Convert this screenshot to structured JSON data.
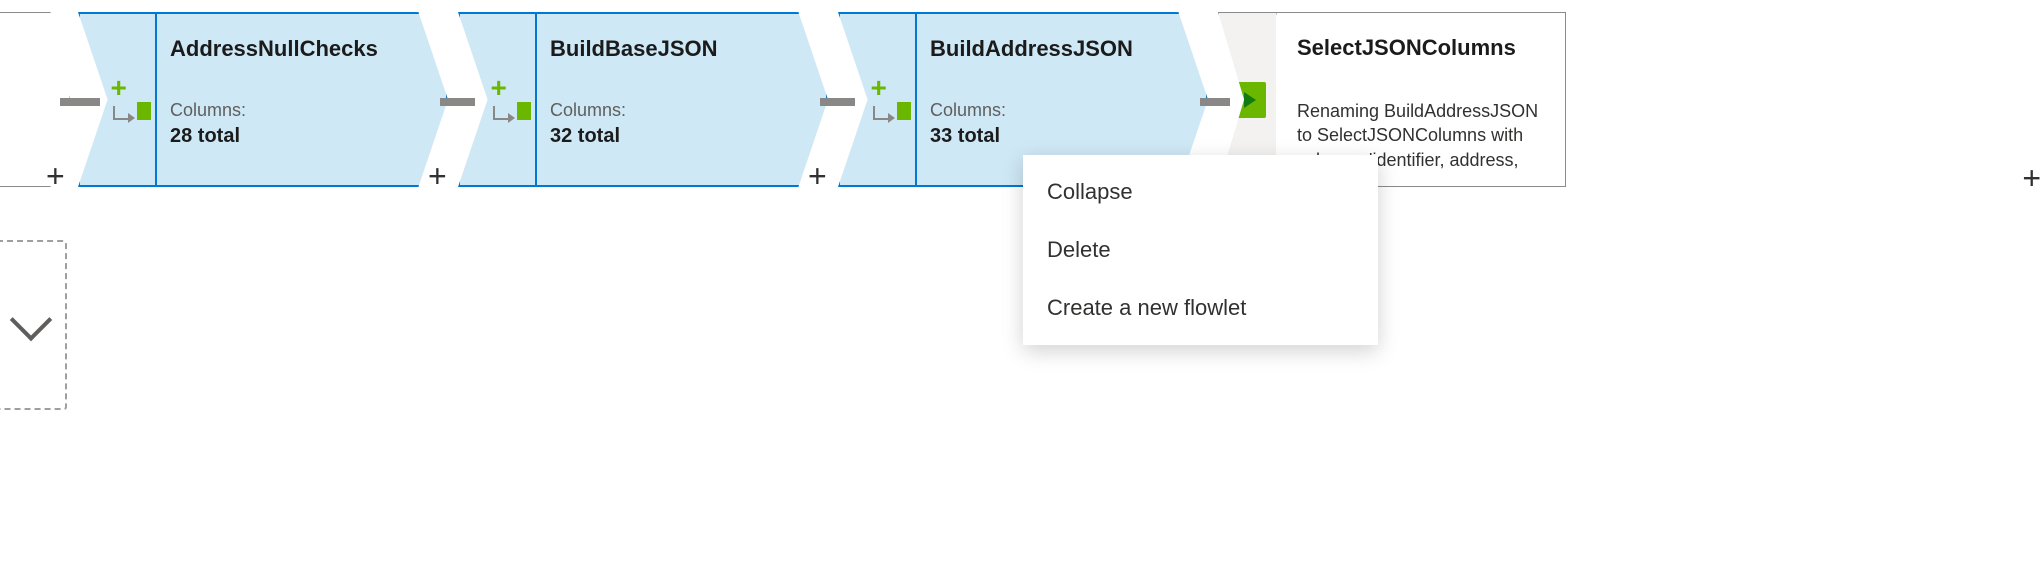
{
  "nodes": {
    "n0": {
      "title": "AddressNullChecks",
      "columns_label": "Columns:",
      "columns_value": "28 total"
    },
    "n1": {
      "title": "BuildBaseJSON",
      "columns_label": "Columns:",
      "columns_value": "32 total"
    },
    "n2": {
      "title": "BuildAddressJSON",
      "columns_label": "Columns:",
      "columns_value": "33 total"
    },
    "n3": {
      "title": "SelectJSONColumns",
      "description": "Renaming BuildAddressJSON to SelectJSONColumns with columns 'identifier, address,"
    }
  },
  "plus_label": "+",
  "context_menu": {
    "collapse": "Collapse",
    "delete": "Delete",
    "create_flowlet": "Create a new flowlet"
  }
}
